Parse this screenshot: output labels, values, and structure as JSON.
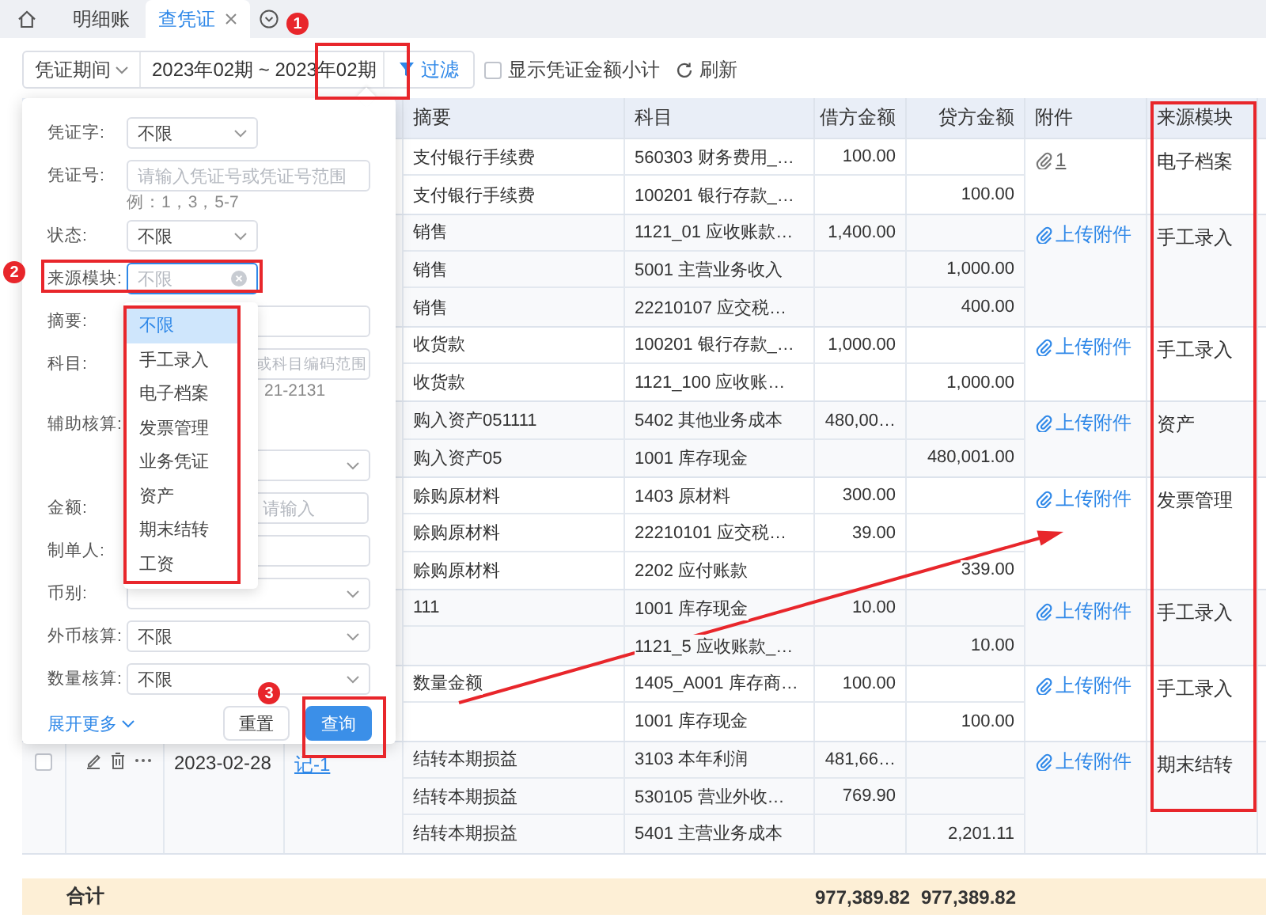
{
  "tabs": [
    {
      "label": "明细账",
      "selected": false
    },
    {
      "label": "查凭证",
      "selected": true
    }
  ],
  "toolbar": {
    "period_type": "凭证期间",
    "period_range": "2023年02期 ~ 2023年02期",
    "filter_button": "过滤",
    "subtotal": {
      "label": "显示凭证金额小计",
      "checked": false
    },
    "refresh": "刷新"
  },
  "filter_panel": {
    "fields": [
      {
        "label": "凭证字:",
        "kind": "select-short",
        "value": "不限",
        "focused": false
      },
      {
        "label": "凭证号:",
        "kind": "input",
        "placeholder": "请输入凭证号或凭证号范围",
        "hint": "例：1，3，5-7",
        "focused": false
      },
      {
        "label": "状态:",
        "kind": "select-short",
        "value": "不限",
        "focused": false
      },
      {
        "label": "来源模块:",
        "kind": "input-short",
        "placeholder": "不限",
        "focused": true,
        "clearable": true
      },
      {
        "label": "摘要:",
        "kind": "input",
        "focused": false
      },
      {
        "label": "科目:",
        "kind": "input",
        "placeholder": "或科目编码范围",
        "hint": "21-2131",
        "partly_hidden": true,
        "focused": false
      },
      {
        "label": "辅助核算:",
        "kind": "select-below",
        "focused": false
      },
      {
        "label": "金额:",
        "kind": "range",
        "placeholder": "请输入",
        "focused": false
      },
      {
        "label": "制单人:",
        "kind": "input",
        "focused": false
      },
      {
        "label": "币别:",
        "kind": "select",
        "focused": false
      },
      {
        "label": "外币核算:",
        "kind": "select",
        "value": "不限",
        "focused": false
      },
      {
        "label": "数量核算:",
        "kind": "select",
        "value": "不限",
        "focused": false
      }
    ],
    "expand_link": "展开更多",
    "buttons": [
      {
        "label": "重置",
        "kind": "default"
      },
      {
        "label": "查询",
        "kind": "primary"
      }
    ]
  },
  "source_dropdown": {
    "options": [
      {
        "label": "不限",
        "selected": true
      },
      {
        "label": "手工录入",
        "selected": false
      },
      {
        "label": "电子档案",
        "selected": false
      },
      {
        "label": "发票管理",
        "selected": false
      },
      {
        "label": "业务凭证",
        "selected": false
      },
      {
        "label": "资产",
        "selected": false
      },
      {
        "label": "期末结转",
        "selected": false
      },
      {
        "label": "工资",
        "selected": false
      }
    ]
  },
  "table": {
    "columns": [
      "摘要",
      "科目",
      "借方金额",
      "贷方金额",
      "附件",
      "来源模块"
    ],
    "groups": [
      {
        "attachment": {
          "kind": "count",
          "label": "1"
        },
        "source": "电子档案",
        "rows": [
          {
            "summary": "支付银行手续费",
            "account": "560303 财务费用_…",
            "debit": "100.00"
          },
          {
            "summary": "支付银行手续费",
            "account": "100201 银行存款_…",
            "credit": "100.00"
          }
        ]
      },
      {
        "attachment": {
          "kind": "upload",
          "label": "上传附件"
        },
        "source": "手工录入",
        "rows": [
          {
            "summary": "销售",
            "account": "1121_01 应收账款…",
            "debit": "1,400.00"
          },
          {
            "summary": "销售",
            "account": "5001 主营业务收入",
            "credit": "1,000.00"
          },
          {
            "summary": "销售",
            "account": "22210107 应交税…",
            "credit": "400.00"
          }
        ]
      },
      {
        "attachment": {
          "kind": "upload",
          "label": "上传附件"
        },
        "source": "手工录入",
        "rows": [
          {
            "summary": "收货款",
            "account": "100201 银行存款_…",
            "debit": "1,000.00"
          },
          {
            "summary": "收货款",
            "account": "1121_100 应收账…",
            "credit": "1,000.00"
          }
        ]
      },
      {
        "attachment": {
          "kind": "upload",
          "label": "上传附件"
        },
        "source": "资产",
        "rows": [
          {
            "summary": "购入资产051111",
            "account": "5402 其他业务成本",
            "debit": "480,00…"
          },
          {
            "summary": "购入资产05",
            "account": "1001 库存现金",
            "credit": "480,001.00"
          }
        ]
      },
      {
        "attachment": {
          "kind": "upload",
          "label": "上传附件"
        },
        "source": "发票管理",
        "rows": [
          {
            "summary": "赊购原材料",
            "account": "1403 原材料",
            "debit": "300.00"
          },
          {
            "summary": "赊购原材料",
            "account": "22210101 应交税…",
            "debit": "39.00"
          },
          {
            "summary": "赊购原材料",
            "account": "2202 应付账款",
            "credit": "339.00"
          }
        ]
      },
      {
        "attachment": {
          "kind": "upload",
          "label": "上传附件"
        },
        "source": "手工录入",
        "rows": [
          {
            "summary": "111",
            "account": "1001 库存现金",
            "debit": "10.00"
          },
          {
            "account": "1121_5 应收账款_…",
            "credit": "10.00"
          }
        ]
      },
      {
        "attachment": {
          "kind": "upload",
          "label": "上传附件"
        },
        "source": "手工录入",
        "rows": [
          {
            "summary": "数量金额",
            "account": "1405_A001 库存商…",
            "debit": "100.00"
          },
          {
            "account": "1001 库存现金",
            "credit": "100.00"
          }
        ]
      },
      {
        "checked": false,
        "date": "2023-02-28",
        "voucher_no": "记-1",
        "attachment": {
          "kind": "upload",
          "label": "上传附件"
        },
        "source": "期末结转",
        "rows": [
          {
            "summary": "结转本期损益",
            "account": "3103 本年利润",
            "debit": "481,66…"
          },
          {
            "summary": "结转本期损益",
            "account": "530105 营业外收…",
            "debit": "769.90"
          },
          {
            "summary": "结转本期损益",
            "account": "5401 主营业务成本",
            "credit": "2,201.11"
          }
        ]
      }
    ],
    "total": {
      "label": "合计",
      "debit": "977,389.82",
      "credit": "977,389.82"
    }
  },
  "annotations": {
    "steps": [
      "1",
      "2",
      "3"
    ]
  }
}
